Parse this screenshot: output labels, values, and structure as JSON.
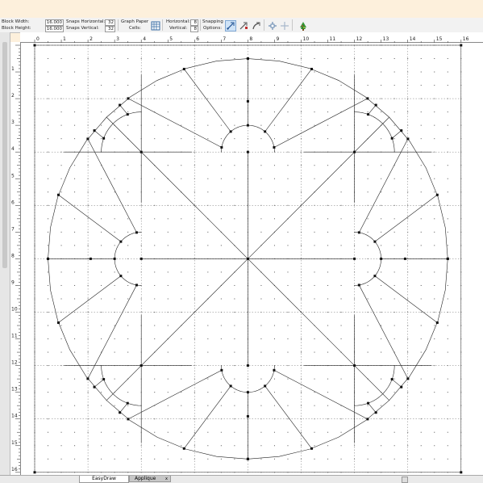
{
  "toolbar": {
    "block_width_label": "Block Width:",
    "block_width_value": "16.000",
    "block_height_label": "Block Height:",
    "block_height_value": "16.000",
    "snaps_horizontal_label": "Snaps Horizontal:",
    "snaps_horizontal_value": "32",
    "snaps_vertical_label": "Snaps Vertical:",
    "snaps_vertical_value": "32",
    "graph_paper_label": "Graph Paper",
    "cells_label": "Cells:",
    "horizontal_label": "Horizontal:",
    "horizontal_value": "8",
    "vertical_label": "Vertical:",
    "vertical_value": "8",
    "snapping_label": "Snapping",
    "options_label": "Options:",
    "icons": [
      "graph-paper-icon",
      "snap-to-grid-icon",
      "snap-to-node-icon",
      "snap-to-drawing-icon",
      "add-node-icon",
      "delete-node-icon",
      "color-tree-icon"
    ]
  },
  "rulers": {
    "top_labels": [
      "0",
      "1",
      "2",
      "3",
      "4",
      "5",
      "6",
      "7",
      "8",
      "9",
      "10",
      "11",
      "12",
      "13",
      "14",
      "15",
      "16"
    ],
    "left_labels": [
      "1",
      "2",
      "3",
      "4",
      "5",
      "6",
      "7",
      "8",
      "9",
      "10",
      "11",
      "12",
      "13",
      "14",
      "15",
      "16"
    ]
  },
  "tabs": [
    {
      "label": "EasyDraw",
      "active": true
    },
    {
      "label": "Applique",
      "active": false
    }
  ],
  "colors": {
    "background": "#fdf0dc",
    "toolbar": "#f2f2f2",
    "active_icon": "#cfe3f7",
    "line": "#222222"
  }
}
